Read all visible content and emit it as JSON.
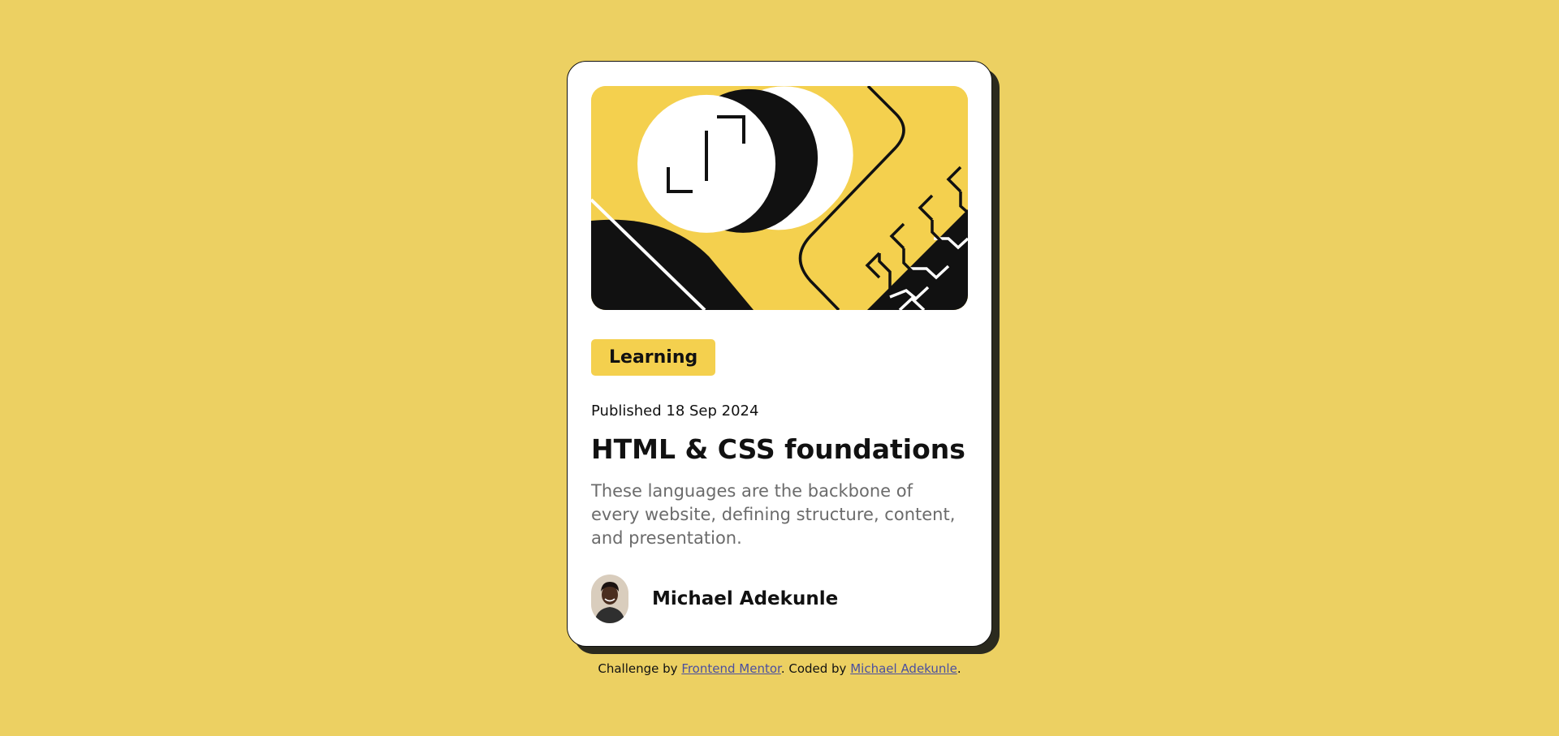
{
  "card": {
    "tag": "Learning",
    "published": "Published 18 Sep 2024",
    "title": "HTML & CSS foundations",
    "description": "These languages are the backbone of every website, defining structure, content, and presentation.",
    "author": {
      "name": "Michael Adekunle"
    }
  },
  "attribution": {
    "prefix": "Challenge by ",
    "challenge_link": "Frontend Mentor",
    "middle": ". Coded by ",
    "coder_link": "Michael Adekunle",
    "suffix": "."
  },
  "colors": {
    "background": "#ecd062",
    "accent_yellow": "#f4d04e",
    "ink": "#111111",
    "muted_text": "#6b6b6b",
    "link": "#4a4fa0"
  },
  "icons": {
    "hero": "code-illustration",
    "avatar": "author-photo"
  }
}
